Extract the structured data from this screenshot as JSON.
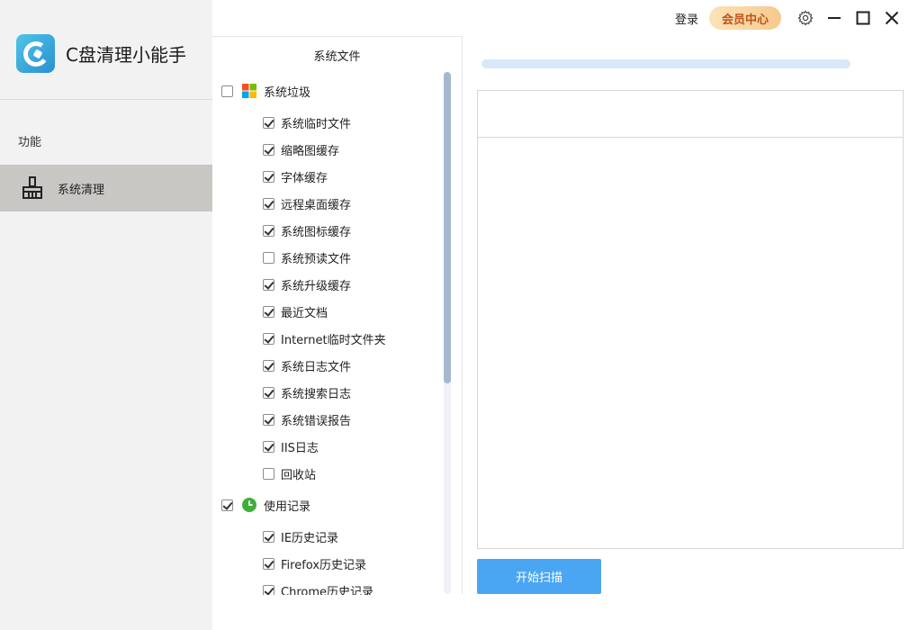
{
  "app": {
    "title": "C盘清理小能手"
  },
  "sidebar": {
    "section_label": "功能",
    "items": [
      {
        "label": "系统清理",
        "icon": "broom-icon",
        "active": true
      }
    ]
  },
  "titlebar": {
    "login_label": "登录",
    "vip_label": "会员中心"
  },
  "tree": {
    "header": "系统文件",
    "groups": [
      {
        "label": "系统垃圾",
        "icon": "windows-logo-icon",
        "checked": false,
        "items": [
          {
            "label": "系统临时文件",
            "checked": true
          },
          {
            "label": "缩略图缓存",
            "checked": true
          },
          {
            "label": "字体缓存",
            "checked": true
          },
          {
            "label": "远程桌面缓存",
            "checked": true
          },
          {
            "label": "系统图标缓存",
            "checked": true
          },
          {
            "label": "系统预读文件",
            "checked": false
          },
          {
            "label": "系统升级缓存",
            "checked": true
          },
          {
            "label": "最近文档",
            "checked": true
          },
          {
            "label": "Internet临时文件夹",
            "checked": true
          },
          {
            "label": "系统日志文件",
            "checked": true
          },
          {
            "label": "系统搜索日志",
            "checked": true
          },
          {
            "label": "系统错误报告",
            "checked": true
          },
          {
            "label": "IIS日志",
            "checked": true
          },
          {
            "label": "回收站",
            "checked": false
          }
        ]
      },
      {
        "label": "使用记录",
        "icon": "clock-icon",
        "checked": true,
        "items": [
          {
            "label": "IE历史记录",
            "checked": true
          },
          {
            "label": "Firefox历史记录",
            "checked": true
          },
          {
            "label": "Chrome历史记录",
            "checked": true
          }
        ]
      }
    ]
  },
  "scan": {
    "button_label": "开始扫描",
    "progress": 0
  },
  "colors": {
    "accent": "#4aa6f2",
    "vip_text": "#c0521b",
    "sidebar_active": "#c9c7c4"
  }
}
